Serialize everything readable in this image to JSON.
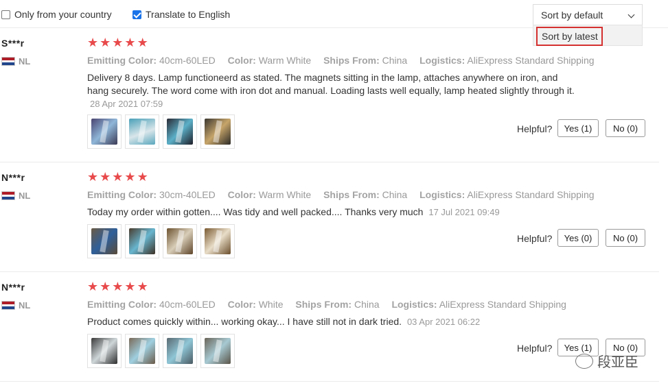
{
  "filters": {
    "only_country": {
      "label": "Only from your country",
      "checked": false
    },
    "translate": {
      "label": "Translate to English",
      "checked": true
    }
  },
  "sort": {
    "selected": "Sort by default",
    "options": [
      "Sort by latest"
    ]
  },
  "labels": {
    "emitting_color": "Emitting Color:",
    "color": "Color:",
    "ships_from": "Ships From:",
    "logistics": "Logistics:",
    "helpful": "Helpful?"
  },
  "reviews": [
    {
      "user": "S***r",
      "country": "NL",
      "rating": 5,
      "emitting_color": "40cm-60LED",
      "color": "Warm White",
      "ships_from": "China",
      "logistics": "AliExpress Standard Shipping",
      "text": "Delivery 8 days. Lamp functioneerd as stated. The magnets sitting in the lamp, attaches anywhere on iron, and hang securely. The word come with iron dot and manual. Loading lasts well equally, lamp heated slightly through it.",
      "date": "28 Apr 2021 07:59",
      "photos": 4,
      "yes": "Yes (1)",
      "no": "No (0)"
    },
    {
      "user": "N***r",
      "country": "NL",
      "rating": 5,
      "emitting_color": "30cm-40LED",
      "color": "Warm White",
      "ships_from": "China",
      "logistics": "AliExpress Standard Shipping",
      "text": "Today my order within gotten.... Was tidy and well packed.... Thanks very much",
      "date": "17 Jul 2021 09:49",
      "photos": 4,
      "yes": "Yes (0)",
      "no": "No (0)"
    },
    {
      "user": "N***r",
      "country": "NL",
      "rating": 5,
      "emitting_color": "40cm-60LED",
      "color": "White",
      "ships_from": "China",
      "logistics": "AliExpress Standard Shipping",
      "text": "Product comes quickly within... working okay... I have still not in dark tried.",
      "date": "03 Apr 2021 06:22",
      "photos": 4,
      "yes": "Yes (1)",
      "no": "No (0)"
    }
  ],
  "watermark": "段亚臣",
  "colors": {
    "star": "#e8494b",
    "highlight_border": "#d3302f",
    "checkbox_checked": "#1a73e8"
  }
}
